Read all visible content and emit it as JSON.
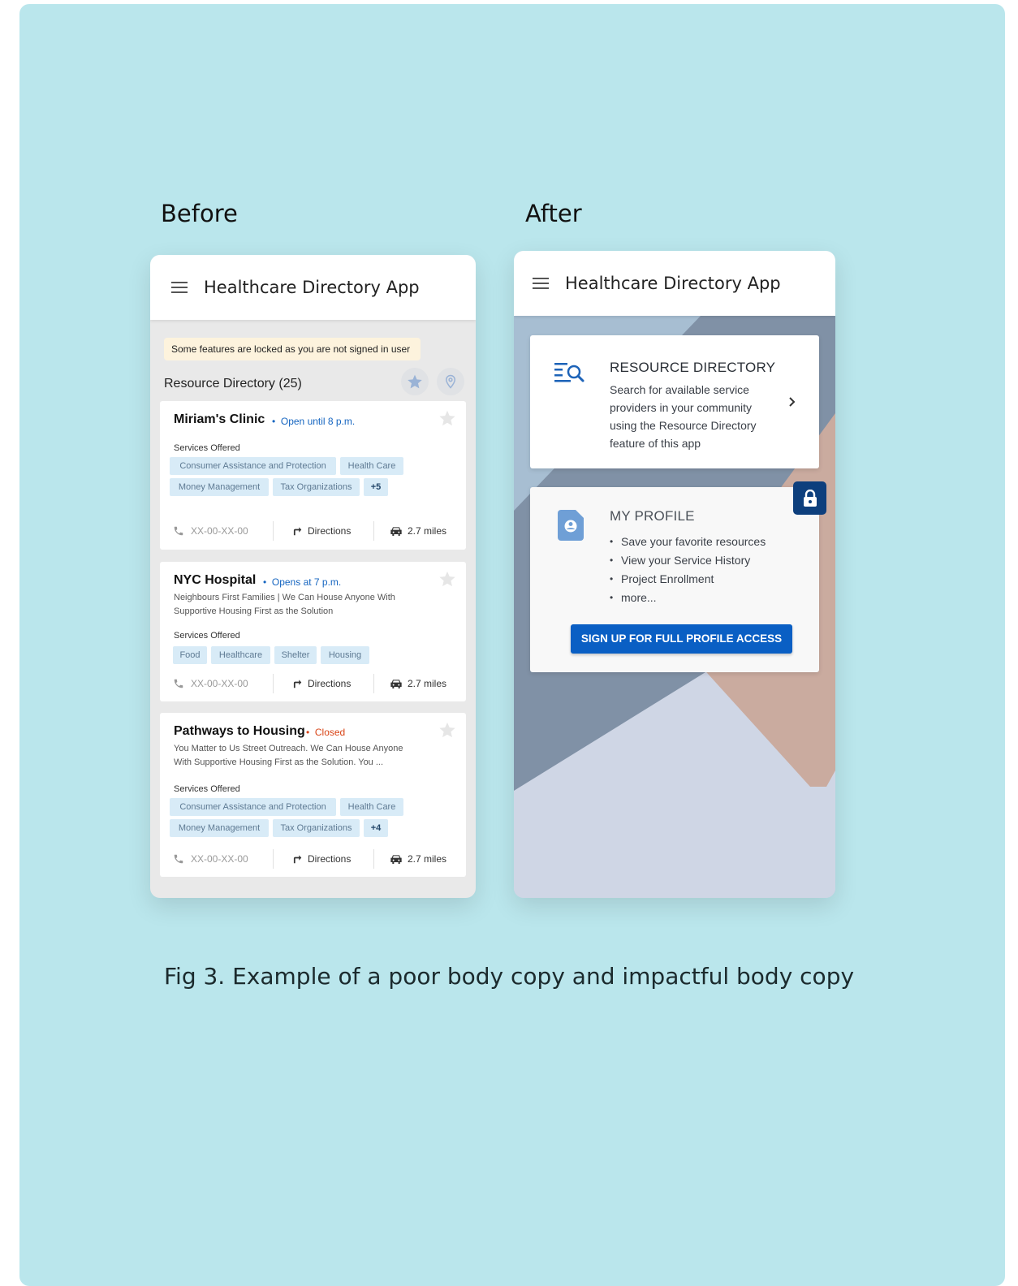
{
  "headings": {
    "before": "Before",
    "after": "After"
  },
  "caption": "Fig 3. Example of a poor body copy and impactful body copy",
  "app_title": "Healthcare Directory App",
  "before": {
    "banner": "Some features are locked as you are not signed in user",
    "directory_title": "Resource Directory (25)",
    "services_label": "Services Offered",
    "cards": [
      {
        "name": "Miriam's Clinic",
        "status": "Open until 8 p.m.",
        "status_color": "#1565c0",
        "description": "",
        "chips": [
          "Consumer Assistance and Protection",
          "Health Care",
          "Money Management",
          "Tax Organizations",
          "+5"
        ],
        "phone": "XX-00-XX-00",
        "directions": "Directions",
        "distance": "2.7 miles"
      },
      {
        "name": "NYC Hospital",
        "status": "Opens at 7 p.m.",
        "status_color": "#1565c0",
        "description": "Neighbours First Families | We Can House Anyone With Supportive Housing First as the Solution",
        "chips": [
          "Food",
          "Healthcare",
          "Shelter",
          "Housing"
        ],
        "phone": "XX-00-XX-00",
        "directions": "Directions",
        "distance": "2.7 miles"
      },
      {
        "name": "Pathways to Housing",
        "status": "Closed",
        "status_color": "#d84315",
        "description": "You Matter to Us Street Outreach. We Can House Anyone With Supportive Housing First as the Solution. You ...",
        "chips": [
          "Consumer Assistance and Protection",
          "Health Care",
          "Money Management",
          "Tax Organizations",
          "+4"
        ],
        "phone": "XX-00-XX-00",
        "directions": "Directions",
        "distance": "2.7 miles"
      }
    ]
  },
  "after": {
    "resource_card": {
      "title": "RESOURCE DIRECTORY",
      "body": "Search for available service providers in your community using the Resource Directory feature of this app"
    },
    "profile_card": {
      "title": "MY PROFILE",
      "bullets": [
        "Save your favorite resources",
        "View your Service History",
        "Project Enrollment",
        "more..."
      ],
      "button": "SIGN UP FOR FULL PROFILE ACCESS"
    }
  },
  "colors": {
    "background": "#bae6ec",
    "primary_button": "#0a5fc4",
    "lock_badge": "#0d3f7d",
    "chip_bg": "#d8ebf7"
  }
}
